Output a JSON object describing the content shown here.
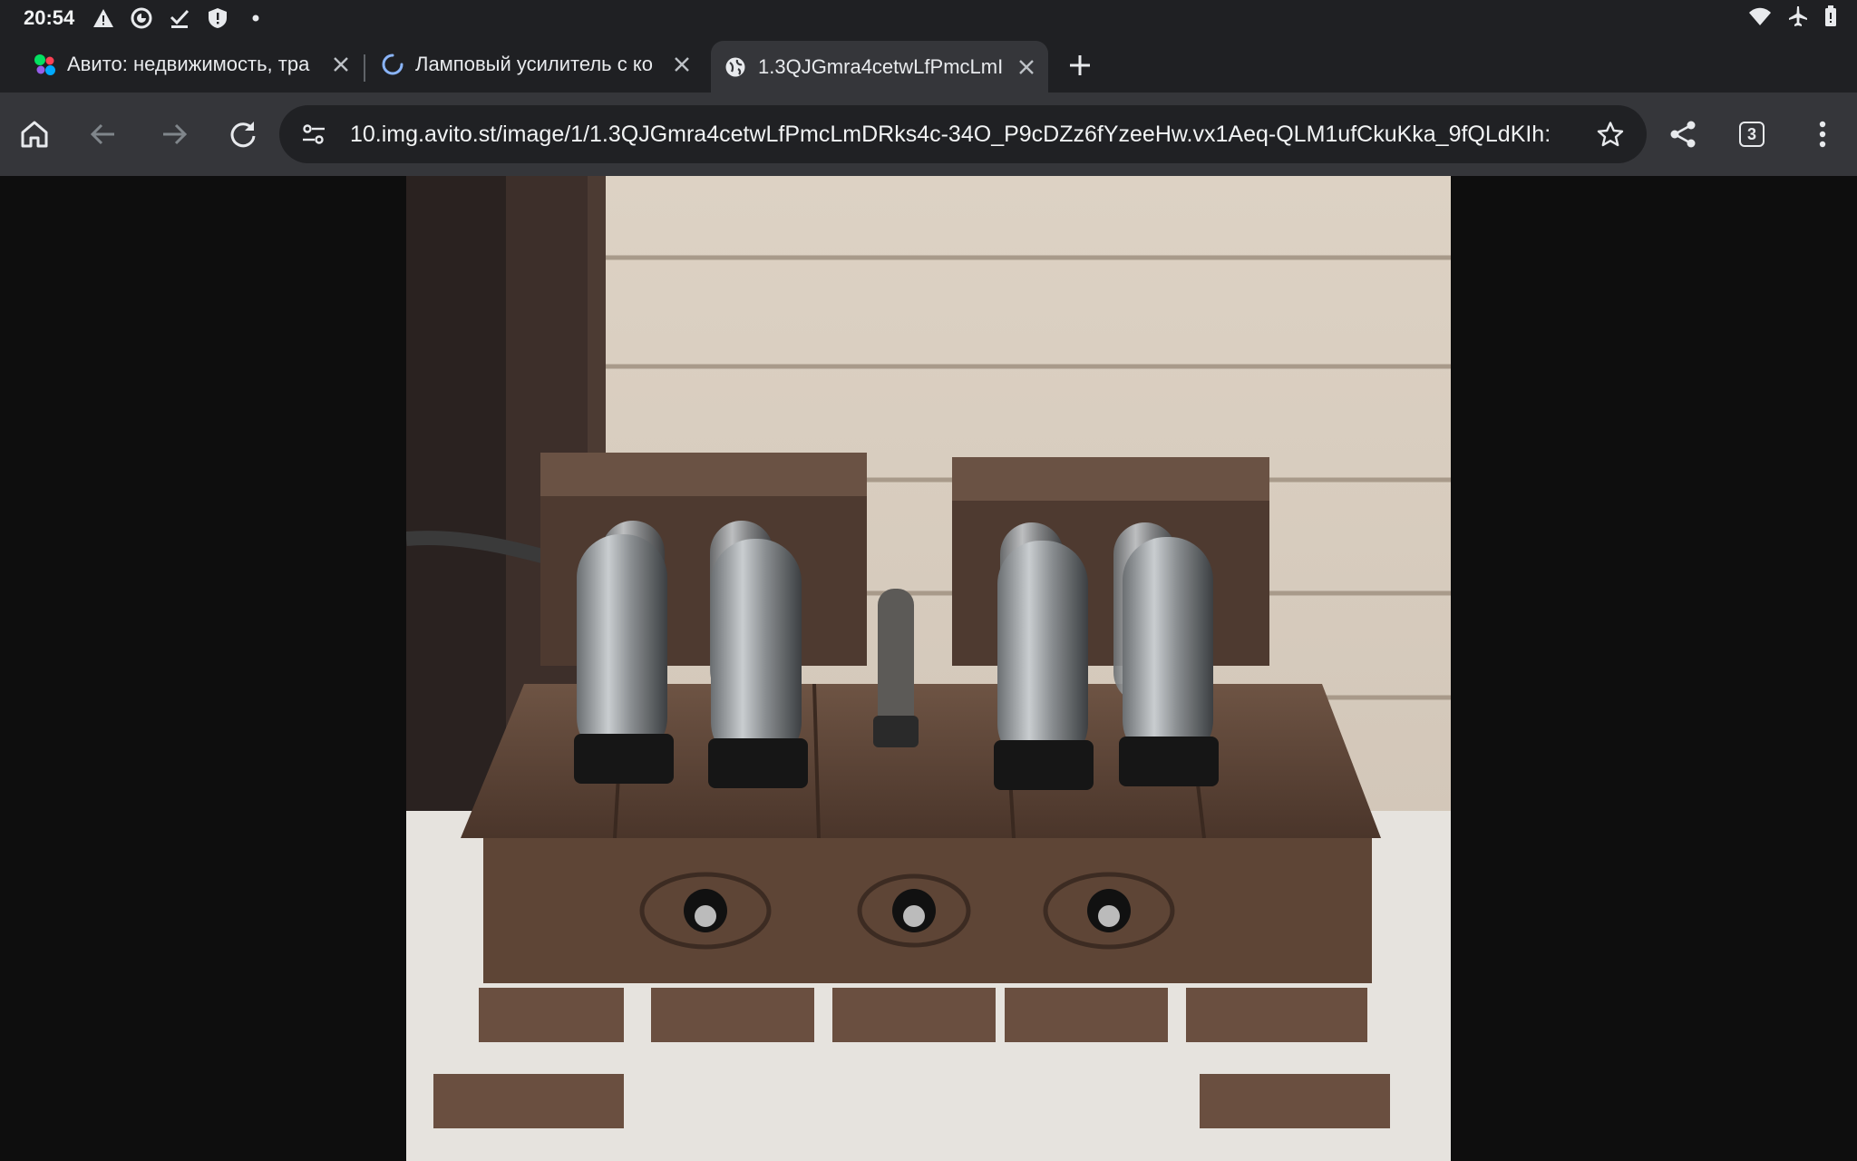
{
  "status_bar": {
    "time": "20:54",
    "left_icons": [
      "warning-icon",
      "vpn-key-icon",
      "download-done-icon",
      "shield-alert-icon",
      "dot-icon"
    ],
    "right_icons": [
      "wifi-icon",
      "airplane-mode-icon",
      "battery-icon"
    ]
  },
  "tabs": [
    {
      "title": "Авито: недвижимость, тра",
      "favicon": "avito-logo-icon",
      "active": false
    },
    {
      "title": "Ламповый усилитель с ко",
      "favicon": "loading-spinner-icon",
      "active": false
    },
    {
      "title": "1.3QJGmra4cetwLfPmcLmI",
      "favicon": "globe-icon",
      "active": true
    }
  ],
  "toolbar": {
    "url": "10.img.avito.st/image/1/1.3QJGmra4cetwLfPmcLmDRks4c-34O_P9cDZz6fYzeeHw.vx1Aeq-QLM1ufCkuKka_9fQLdKIh:",
    "tab_count": "3"
  },
  "content": {
    "image_description": "handmade-tube-amplifier-photo"
  },
  "colors": {
    "chrome_dark": "#1f2023",
    "toolbar": "#35363a",
    "omnibox": "#202124",
    "spinner_blue": "#8ab4f8"
  }
}
